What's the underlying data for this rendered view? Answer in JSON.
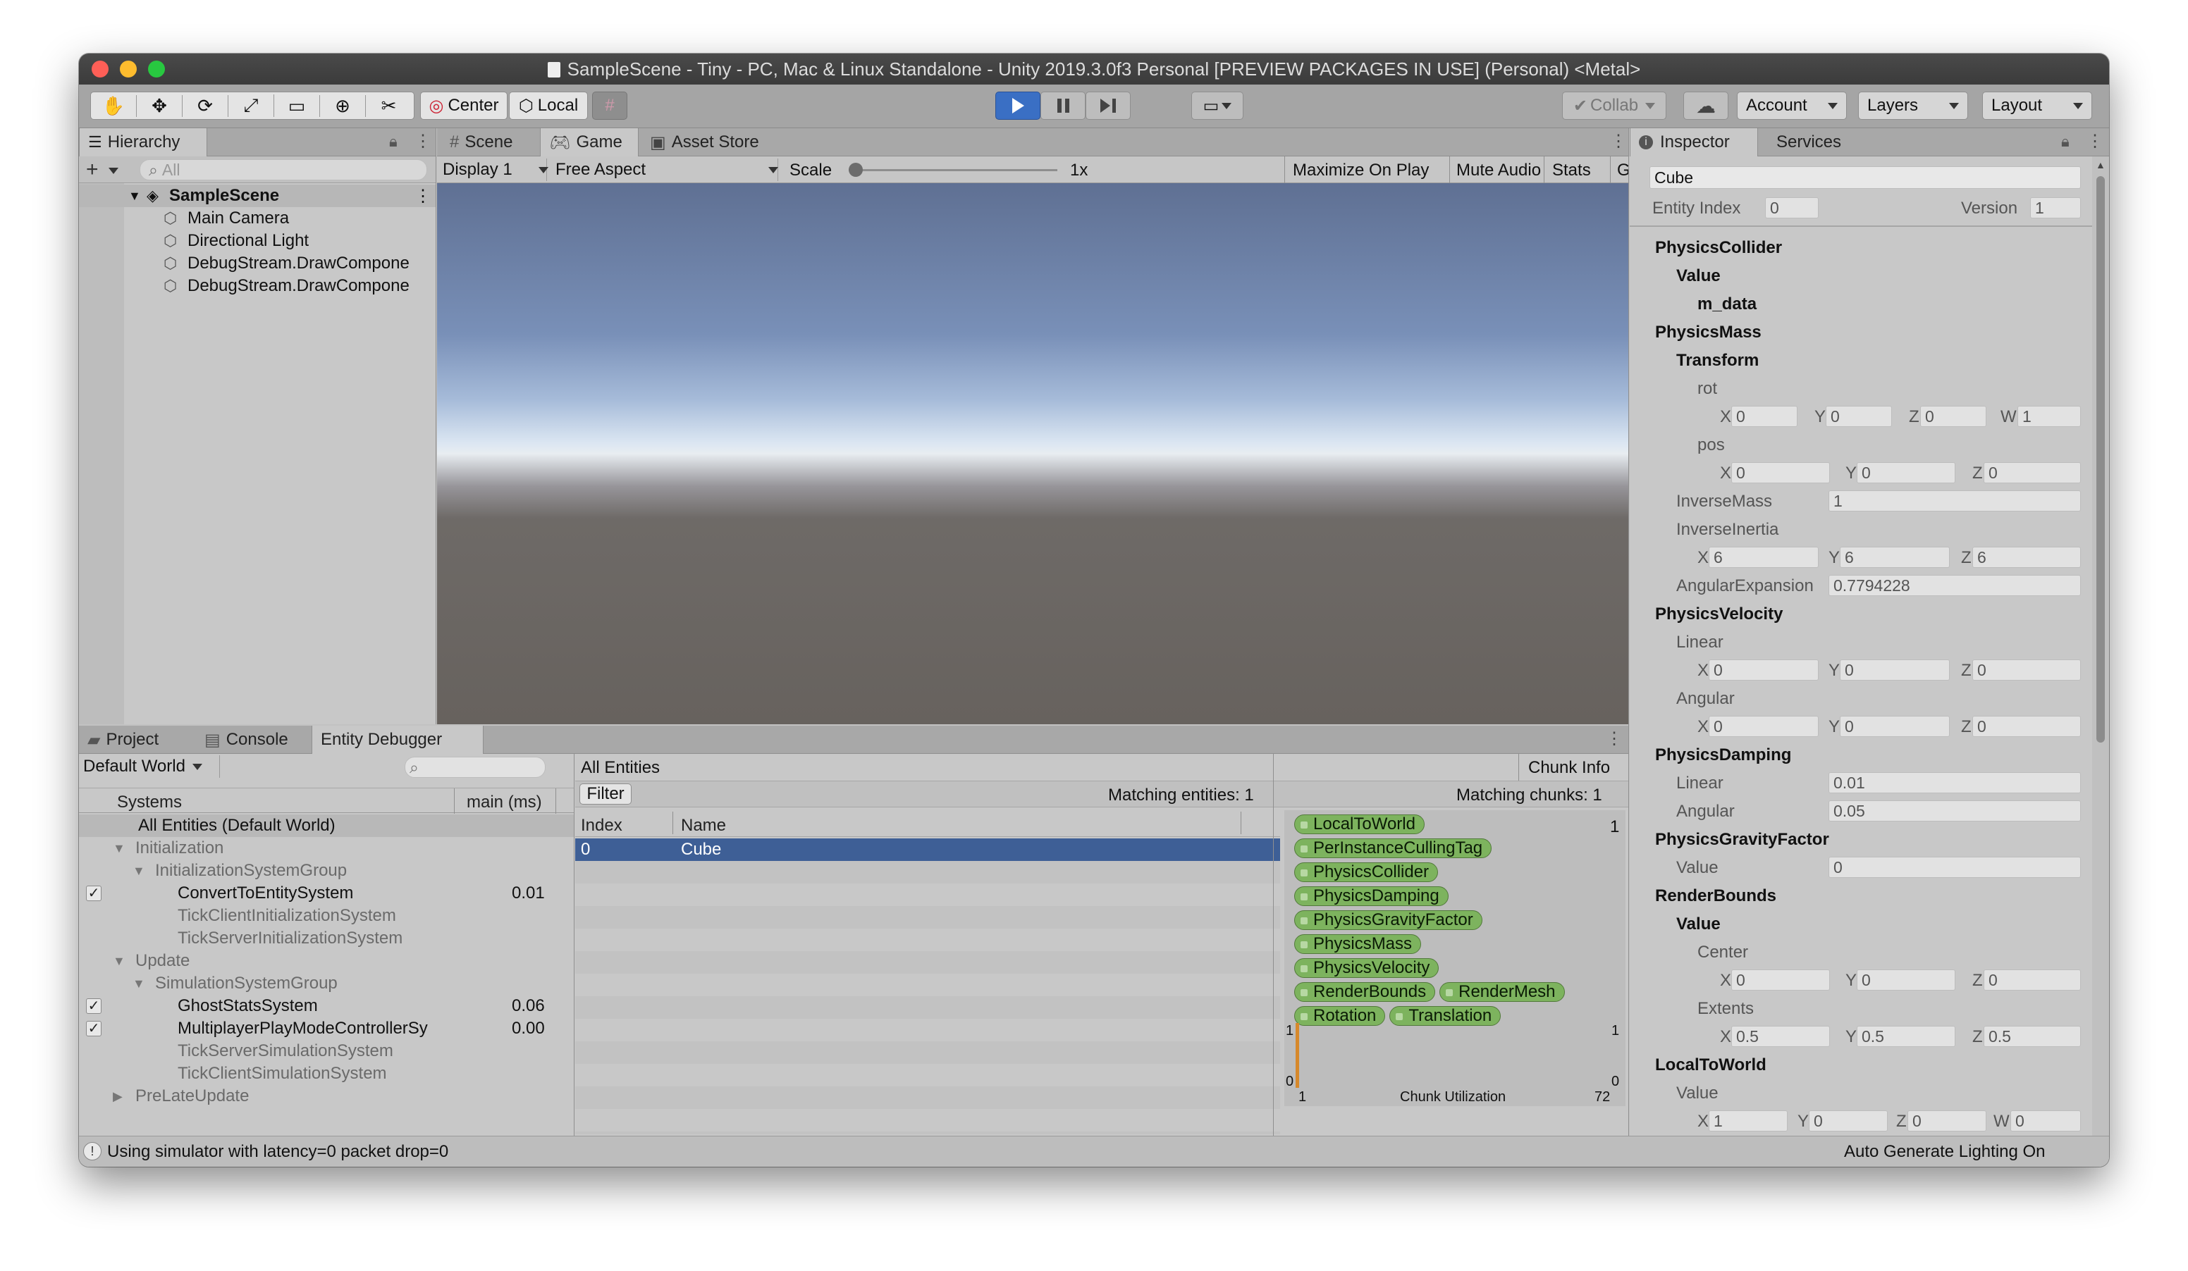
{
  "window": {
    "title": "SampleScene - Tiny - PC, Mac & Linux Standalone - Unity 2019.3.0f3 Personal [PREVIEW PACKAGES IN USE] (Personal) <Metal>"
  },
  "toolbar": {
    "tool_icons": [
      "hand-icon",
      "move-icon",
      "rotate-icon",
      "scale-icon",
      "rect-icon",
      "transform-icon",
      "custom-tool-icon"
    ],
    "pivot_mode": "Center",
    "pivot_rotation": "Local",
    "collab": "Collab",
    "account": "Account",
    "layers": "Layers",
    "layout": "Layout"
  },
  "hierarchy": {
    "tab": "Hierarchy",
    "search_placeholder": "All",
    "scene": "SampleScene",
    "items": [
      "Main Camera",
      "Directional Light",
      "DebugStream.DrawCompone",
      "DebugStream.DrawCompone"
    ]
  },
  "center_tabs": {
    "scene": "Scene",
    "game": "Game",
    "asset_store": "Asset Store"
  },
  "game_bar": {
    "display": "Display 1",
    "aspect": "Free Aspect",
    "scale_label": "Scale",
    "scale_value": "1x",
    "scale_level": 0,
    "maximize": "Maximize On Play",
    "mute": "Mute Audio",
    "stats": "Stats",
    "gizmos": "Gizmos"
  },
  "inspector": {
    "tab": "Inspector",
    "services_tab": "Services",
    "name": "Cube",
    "entity_index_label": "Entity Index",
    "entity_index": "0",
    "version_label": "Version",
    "version": "1",
    "physics_collider": {
      "title": "PhysicsCollider",
      "value": "Value",
      "m_data": "m_data"
    },
    "physics_mass": {
      "title": "PhysicsMass",
      "transform": "Transform",
      "rot": "rot",
      "rot_x": "0",
      "rot_y": "0",
      "rot_z": "0",
      "rot_w": "1",
      "pos": "pos",
      "pos_x": "0",
      "pos_y": "0",
      "pos_z": "0",
      "inverse_mass_label": "InverseMass",
      "inverse_mass": "1",
      "inverse_inertia_label": "InverseInertia",
      "ii_x": "6",
      "ii_y": "6",
      "ii_z": "6",
      "angular_expansion_label": "AngularExpansion",
      "angular_expansion": "0.7794228"
    },
    "physics_velocity": {
      "title": "PhysicsVelocity",
      "linear": "Linear",
      "lin_x": "0",
      "lin_y": "0",
      "lin_z": "0",
      "angular": "Angular",
      "ang_x": "0",
      "ang_y": "0",
      "ang_z": "0"
    },
    "physics_damping": {
      "title": "PhysicsDamping",
      "linear_label": "Linear",
      "linear": "0.01",
      "angular_label": "Angular",
      "angular": "0.05"
    },
    "physics_gravity": {
      "title": "PhysicsGravityFactor",
      "value_label": "Value",
      "value": "0"
    },
    "render_bounds": {
      "title": "RenderBounds",
      "value": "Value",
      "center": "Center",
      "c_x": "0",
      "c_y": "0",
      "c_z": "0",
      "extents": "Extents",
      "e_x": "0.5",
      "e_y": "0.5",
      "e_z": "0.5"
    },
    "local_to_world": {
      "title": "LocalToWorld",
      "value": "Value",
      "x": "1",
      "y": "0",
      "z": "0",
      "w": "0"
    },
    "axis": {
      "x": "X",
      "y": "Y",
      "z": "Z",
      "w": "W"
    }
  },
  "bottom_tabs": {
    "project": "Project",
    "console": "Console",
    "entity_debugger": "Entity Debugger"
  },
  "entity_debugger": {
    "world": "Default World",
    "systems_header": "Systems",
    "main_ms_header": "main (ms)",
    "systems": [
      {
        "name": "All Entities (Default World)",
        "ms": "",
        "indent": 0,
        "style": "header"
      },
      {
        "name": "Initialization",
        "ms": "",
        "indent": 1,
        "style": "group"
      },
      {
        "name": "InitializationSystemGroup",
        "ms": "",
        "indent": 2,
        "style": "group"
      },
      {
        "name": "ConvertToEntitySystem",
        "ms": "0.01",
        "indent": 3,
        "style": "active",
        "checked": true
      },
      {
        "name": "TickClientInitializationSystem",
        "ms": "",
        "indent": 3,
        "style": "inactive"
      },
      {
        "name": "TickServerInitializationSystem",
        "ms": "",
        "indent": 3,
        "style": "inactive"
      },
      {
        "name": "Update",
        "ms": "",
        "indent": 1,
        "style": "group"
      },
      {
        "name": "SimulationSystemGroup",
        "ms": "",
        "indent": 2,
        "style": "group"
      },
      {
        "name": "GhostStatsSystem",
        "ms": "0.06",
        "indent": 3,
        "style": "active",
        "checked": true
      },
      {
        "name": "MultiplayerPlayModeControllerSy",
        "ms": "0.00",
        "indent": 3,
        "style": "active",
        "checked": true
      },
      {
        "name": "TickServerSimulationSystem",
        "ms": "",
        "indent": 3,
        "style": "inactive"
      },
      {
        "name": "TickClientSimulationSystem",
        "ms": "",
        "indent": 3,
        "style": "inactive"
      },
      {
        "name": "PreLateUpdate",
        "ms": "",
        "indent": 1,
        "style": "group-collapsed"
      }
    ],
    "all_entities": "All Entities",
    "filter": "Filter",
    "matching_entities": "Matching entities: 1",
    "index_header": "Index",
    "name_header": "Name",
    "entities": [
      {
        "index": "0",
        "name": "Cube"
      }
    ],
    "chunk_info": "Chunk Info",
    "matching_chunks": "Matching chunks: 1",
    "chunk_count": "1",
    "components": [
      "LocalToWorld",
      "PerInstanceCullingTag",
      "PhysicsCollider",
      "PhysicsDamping",
      "PhysicsGravityFactor",
      "PhysicsMass",
      "PhysicsVelocity",
      "RenderBounds",
      "RenderMesh",
      "Rotation",
      "Translation"
    ],
    "graph_y_top": "1",
    "graph_y_bottom": "0",
    "graph_y_top_right": "1",
    "graph_y_bottom_right": "0",
    "graph_x_left": "1",
    "graph_label": "Chunk Utilization",
    "graph_x_right": "72"
  },
  "status_bar": {
    "message": "Using simulator with latency=0 packet drop=0",
    "right": "Auto Generate Lighting On"
  },
  "colors": {
    "play_active": "#3a6fc4",
    "selection": "#3e5f96",
    "component_chip": "#7db35e",
    "chart_line": "#d7892b"
  }
}
